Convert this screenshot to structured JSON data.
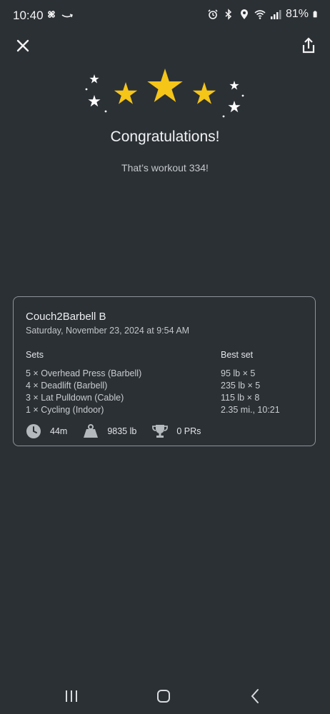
{
  "status_bar": {
    "time": "10:40",
    "battery": "81%",
    "icons": [
      "pinwheel-icon",
      "amazon-icon",
      "alarm-icon",
      "bluetooth-icon",
      "location-icon",
      "wifi-icon",
      "signal-icon",
      "battery-icon"
    ]
  },
  "top_bar": {
    "close_icon": "close-icon",
    "share_icon": "share-icon"
  },
  "hero": {
    "title": "Congratulations!",
    "subtitle": "That’s workout 334!",
    "star_color": "#f5c518"
  },
  "workout": {
    "name": "Couch2Barbell B",
    "date": "Saturday, November 23, 2024 at 9:54 AM",
    "sets_header": "Sets",
    "best_header": "Best set",
    "exercises": [
      {
        "sets": "5 × Overhead Press (Barbell)",
        "best": "95 lb × 5"
      },
      {
        "sets": "4 × Deadlift (Barbell)",
        "best": "235 lb × 5"
      },
      {
        "sets": "3 × Lat Pulldown (Cable)",
        "best": "115 lb × 8"
      },
      {
        "sets": "1 × Cycling (Indoor)",
        "best": "2.35 mi., 10:21"
      }
    ],
    "summary": {
      "duration": "44m",
      "volume": "9835 lb",
      "prs": "0 PRs"
    }
  },
  "nav_bar": {
    "icons": [
      "recents-icon",
      "home-icon",
      "back-icon"
    ]
  }
}
